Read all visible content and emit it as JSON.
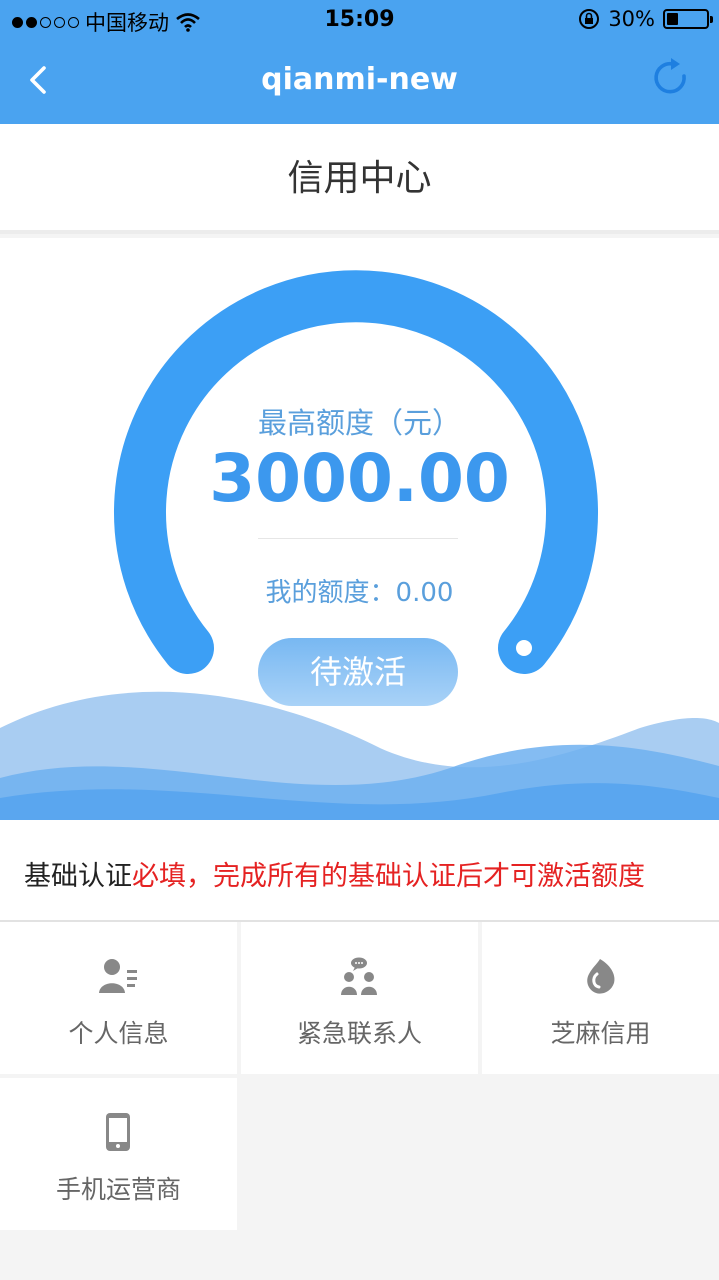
{
  "status_bar": {
    "carrier": "中国移动",
    "time": "15:09",
    "battery": "30%",
    "battery_level": 0.3
  },
  "nav": {
    "title": "qianmi-new",
    "back_icon": "chevron-left-icon",
    "refresh_icon": "refresh-icon"
  },
  "page": {
    "section_title": "信用中心"
  },
  "credit": {
    "max_label": "最高额度（元）",
    "max_value": "3000.00",
    "my_quota": "我的额度：0.00",
    "activate_label": "待激活"
  },
  "basic_auth": {
    "title": "基础认证",
    "notice": "必填，完成所有的基础认证后才可激活额度"
  },
  "items": [
    {
      "label": "个人信息",
      "icon": "person-card-icon"
    },
    {
      "label": "紧急联系人",
      "icon": "contacts-icon"
    },
    {
      "label": "芝麻信用",
      "icon": "sesame-icon"
    },
    {
      "label": "手机运营商",
      "icon": "phone-icon"
    }
  ],
  "colors": {
    "accent": "#4aa3f0",
    "gauge": "#3c9ff5",
    "notice": "#e52222"
  }
}
